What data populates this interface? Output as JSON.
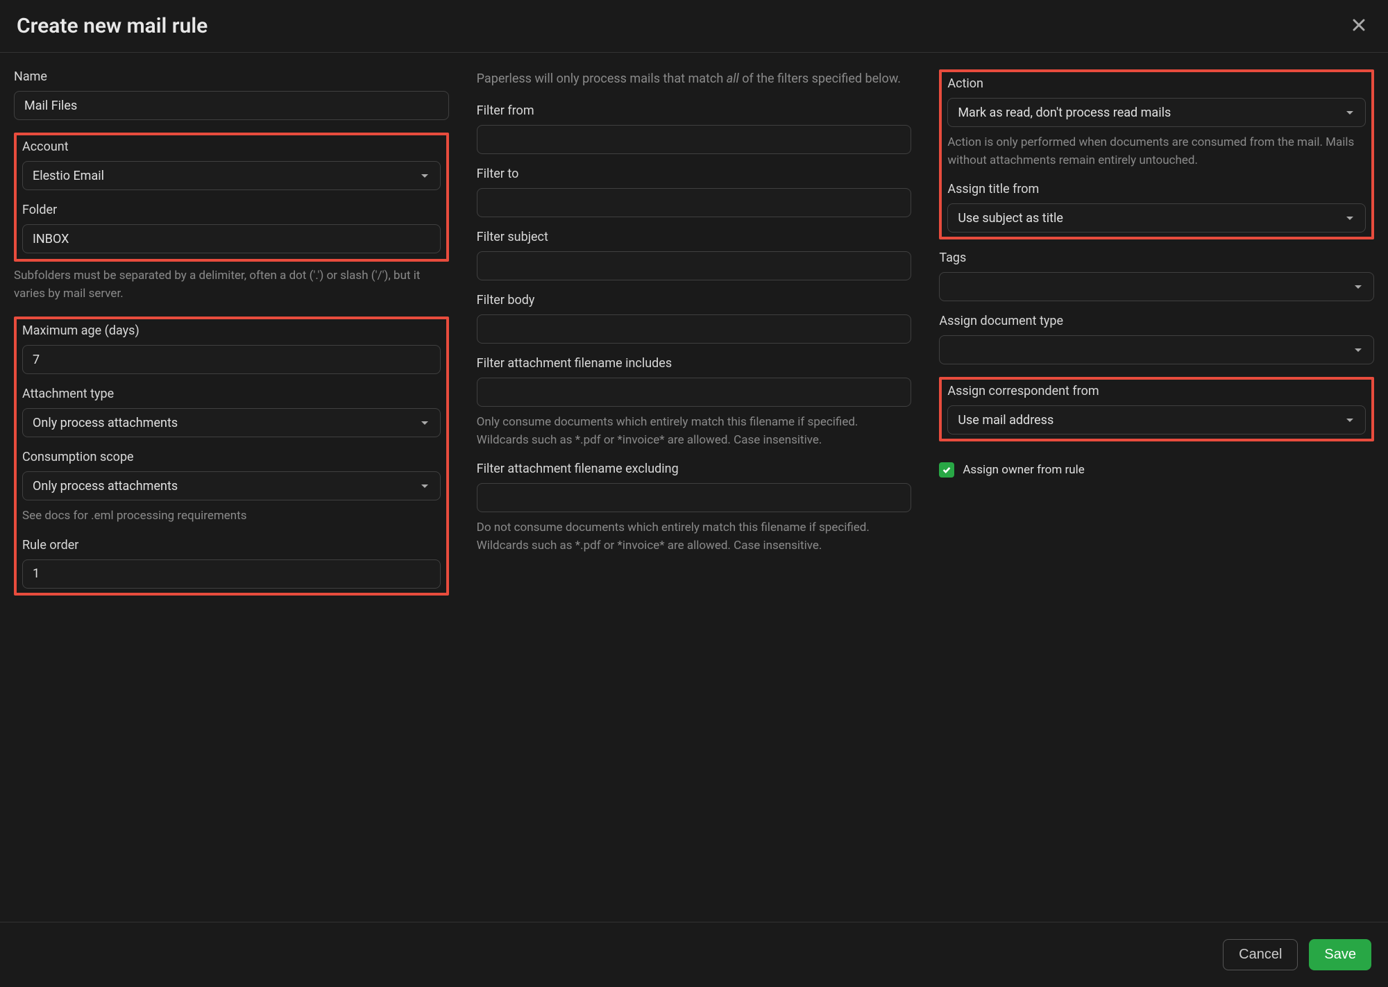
{
  "header": {
    "title": "Create new mail rule"
  },
  "col1": {
    "name": {
      "label": "Name",
      "value": "Mail Files"
    },
    "account": {
      "label": "Account",
      "value": "Elestio Email"
    },
    "folder": {
      "label": "Folder",
      "value": "INBOX",
      "help": "Subfolders must be separated by a delimiter, often a dot ('.') or slash ('/'), but it varies by mail server."
    },
    "max_age": {
      "label": "Maximum age (days)",
      "value": "7"
    },
    "attachment_type": {
      "label": "Attachment type",
      "value": "Only process attachments"
    },
    "consumption_scope": {
      "label": "Consumption scope",
      "value": "Only process attachments",
      "help": "See docs for .eml processing requirements"
    },
    "rule_order": {
      "label": "Rule order",
      "value": "1"
    }
  },
  "col2": {
    "intro_pre": "Paperless will only process mails that match ",
    "intro_em": "all",
    "intro_post": " of the filters specified below.",
    "filter_from": {
      "label": "Filter from"
    },
    "filter_to": {
      "label": "Filter to"
    },
    "filter_subject": {
      "label": "Filter subject"
    },
    "filter_body": {
      "label": "Filter body"
    },
    "filter_filename_includes": {
      "label": "Filter attachment filename includes",
      "help": "Only consume documents which entirely match this filename if specified. Wildcards such as *.pdf or *invoice* are allowed. Case insensitive."
    },
    "filter_filename_excluding": {
      "label": "Filter attachment filename excluding",
      "help": "Do not consume documents which entirely match this filename if specified. Wildcards such as *.pdf or *invoice* are allowed. Case insensitive."
    }
  },
  "col3": {
    "action": {
      "label": "Action",
      "value": "Mark as read, don't process read mails",
      "help": "Action is only performed when documents are consumed from the mail. Mails without attachments remain entirely untouched."
    },
    "assign_title": {
      "label": "Assign title from",
      "value": "Use subject as title"
    },
    "tags": {
      "label": "Tags",
      "value": ""
    },
    "assign_doctype": {
      "label": "Assign document type",
      "value": ""
    },
    "assign_correspondent": {
      "label": "Assign correspondent from",
      "value": "Use mail address"
    },
    "assign_owner": {
      "label": "Assign owner from rule"
    }
  },
  "footer": {
    "cancel": "Cancel",
    "save": "Save"
  }
}
